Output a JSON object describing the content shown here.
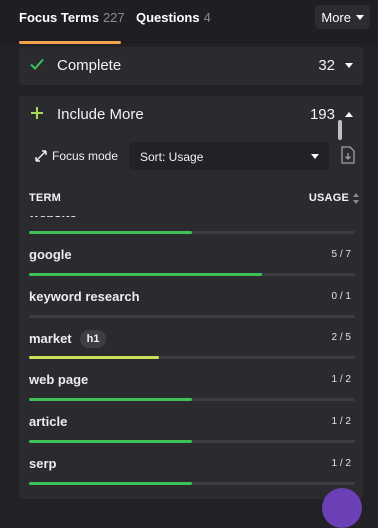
{
  "tabs": [
    {
      "label": "Focus Terms",
      "count": "227"
    },
    {
      "label": "Questions",
      "count": "4"
    }
  ],
  "more_label": "More",
  "complete": {
    "title": "Complete",
    "count": "32"
  },
  "include": {
    "title": "Include More",
    "count": "193"
  },
  "controls": {
    "focus_mode": "Focus mode",
    "sort": "Sort: Usage"
  },
  "columns": {
    "term": "TERM",
    "usage": "USAGE"
  },
  "terms": [
    {
      "term": "website",
      "usage": "",
      "progress": 0.5,
      "color": "#3cc258"
    },
    {
      "term": "google",
      "usage": "5 / 7",
      "progress": 0.714,
      "color": "#3cc258"
    },
    {
      "term": "keyword research",
      "usage": "0 / 1",
      "progress": 0,
      "color": "#3cc258"
    },
    {
      "term": "market",
      "badge": "h1",
      "usage": "2 / 5",
      "progress": 0.4,
      "color": "#c8e05a"
    },
    {
      "term": "web page",
      "usage": "1 / 2",
      "progress": 0.5,
      "color": "#3cc258"
    },
    {
      "term": "article",
      "usage": "1 / 2",
      "progress": 0.5,
      "color": "#3cc258"
    },
    {
      "term": "serp",
      "usage": "1 / 2",
      "progress": 0.5,
      "color": "#3cc258"
    }
  ],
  "colors": {
    "accent": "#f0a14a",
    "success": "#3cc258",
    "partial": "#c8e05a",
    "plus": "#a7d85a"
  }
}
